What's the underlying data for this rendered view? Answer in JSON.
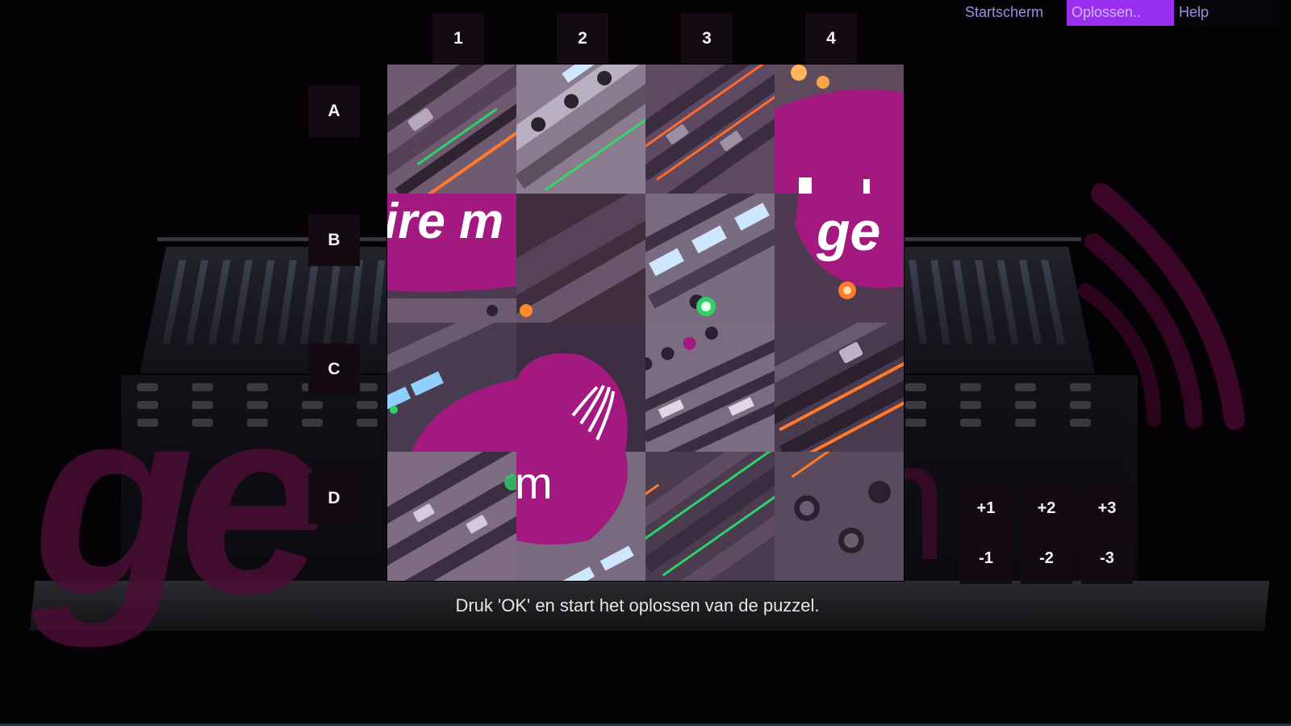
{
  "menu": {
    "home_label": "Startscherm",
    "solve_label": "Oplossen..",
    "help_label": "Help"
  },
  "grid": {
    "columns": [
      "1",
      "2",
      "3",
      "4"
    ],
    "rows": [
      "A",
      "B",
      "C",
      "D"
    ]
  },
  "puzzle": {
    "tiles": [
      {
        "id": "A1"
      },
      {
        "id": "A2"
      },
      {
        "id": "A3"
      },
      {
        "id": "A4"
      },
      {
        "id": "B1",
        "text": "ire m"
      },
      {
        "id": "B2"
      },
      {
        "id": "B3"
      },
      {
        "id": "B4",
        "text": "ge"
      },
      {
        "id": "C1"
      },
      {
        "id": "C2"
      },
      {
        "id": "C3"
      },
      {
        "id": "C4"
      },
      {
        "id": "D1"
      },
      {
        "id": "D2",
        "text": "m"
      },
      {
        "id": "D3"
      },
      {
        "id": "D4"
      }
    ]
  },
  "moves": {
    "plus": [
      "+1",
      "+2",
      "+3"
    ],
    "minus": [
      "-1",
      "-2",
      "-3"
    ]
  },
  "hint": "Druk 'OK' en start het oplossen van de puzzel.",
  "background": {
    "logo": "ge",
    "logo_suffix": "m"
  },
  "colors": {
    "brand_magenta": "#a3197f",
    "menu_highlight": "#9b2ff0",
    "menu_text": "#9c8fe0",
    "label_bg": "#140a12"
  }
}
